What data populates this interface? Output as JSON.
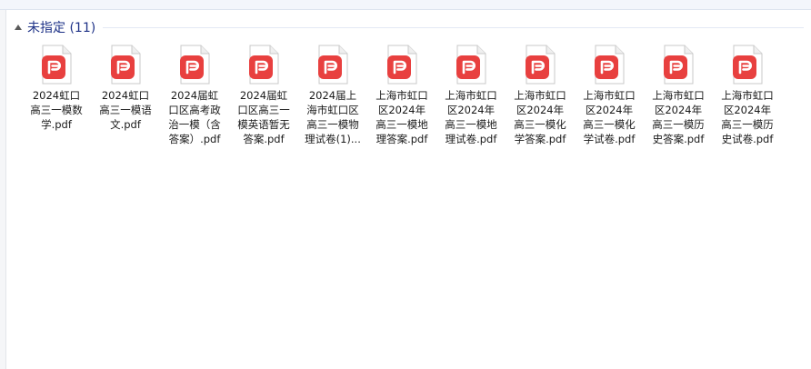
{
  "group": {
    "title": "未指定 (11)"
  },
  "files": [
    {
      "lines": [
        "2024虹口",
        "高三一模数",
        "学.pdf"
      ]
    },
    {
      "lines": [
        "2024虹口",
        "高三一模语",
        "文.pdf"
      ]
    },
    {
      "lines": [
        "2024届虹",
        "口区高考政",
        "治一模（含",
        "答案）.pdf"
      ]
    },
    {
      "lines": [
        "2024届虹",
        "口区高三一",
        "模英语暂无",
        "答案.pdf"
      ]
    },
    {
      "lines": [
        "2024届上",
        "海市虹口区",
        "高三一模物",
        "理试卷(1)..."
      ]
    },
    {
      "lines": [
        "上海市虹口",
        "区2024年",
        "高三一模地",
        "理答案.pdf"
      ]
    },
    {
      "lines": [
        "上海市虹口",
        "区2024年",
        "高三一模地",
        "理试卷.pdf"
      ]
    },
    {
      "lines": [
        "上海市虹口",
        "区2024年",
        "高三一模化",
        "学答案.pdf"
      ]
    },
    {
      "lines": [
        "上海市虹口",
        "区2024年",
        "高三一模化",
        "学试卷.pdf"
      ]
    },
    {
      "lines": [
        "上海市虹口",
        "区2024年",
        "高三一模历",
        "史答案.pdf"
      ]
    },
    {
      "lines": [
        "上海市虹口",
        "区2024年",
        "高三一模历",
        "史试卷.pdf"
      ]
    }
  ],
  "icon": {
    "name": "pdf-file-icon",
    "accent": "#e8403f"
  }
}
